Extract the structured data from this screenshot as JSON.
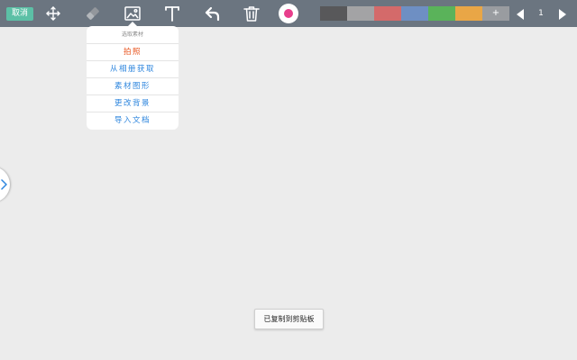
{
  "toolbar": {
    "cancel_label": "取消",
    "tools": [
      {
        "id": "move",
        "icon": "move-arrows-icon"
      },
      {
        "id": "eraser",
        "icon": "eraser-icon"
      },
      {
        "id": "image",
        "icon": "image-icon",
        "active": true
      },
      {
        "id": "text",
        "icon": "text-t-icon"
      },
      {
        "id": "undo",
        "icon": "undo-arrow-icon"
      },
      {
        "id": "delete",
        "icon": "trash-icon"
      }
    ],
    "record_color": "#e83e8c",
    "swatches": [
      "#58585a",
      "#a3a3a5",
      "#d46a6a",
      "#6e8fc3",
      "#5ab35a",
      "#e9a646"
    ],
    "swatch_add_label": "+",
    "page_number": "1"
  },
  "image_menu": {
    "title": "选取素材",
    "items": [
      {
        "label": "拍照",
        "accent": true
      },
      {
        "label": "从相册获取"
      },
      {
        "label": "素材图形"
      },
      {
        "label": "更改背景"
      },
      {
        "label": "导入文档"
      }
    ]
  },
  "toast": "已复制到剪贴板",
  "colors": {
    "toolbar_bg": "#6b7580",
    "canvas_bg": "#ececec",
    "cancel_bg": "#5cc0a6",
    "menu_link": "#2e86de",
    "menu_accent": "#e8541e"
  }
}
